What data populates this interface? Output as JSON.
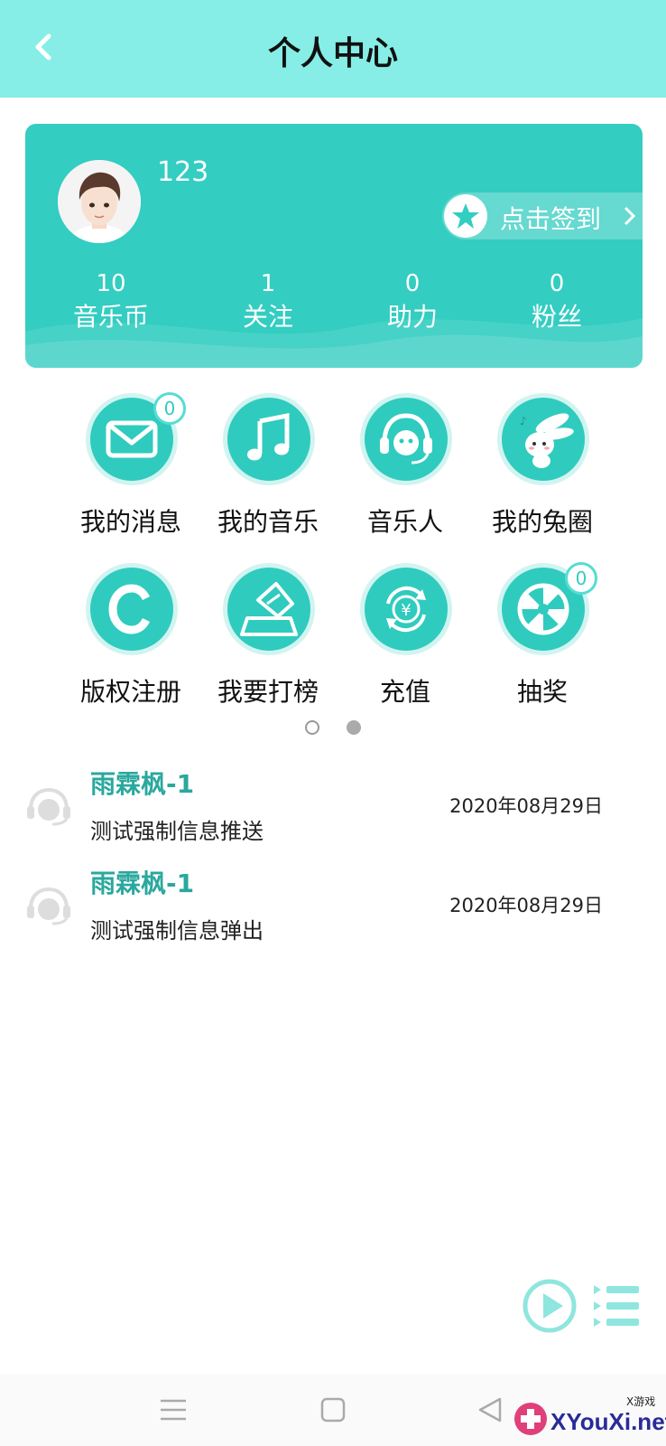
{
  "header": {
    "title": "个人中心"
  },
  "profile": {
    "username": "123",
    "checkin_label": "点击签到",
    "stats": [
      {
        "value": "10",
        "label": "音乐币"
      },
      {
        "value": "1",
        "label": "关注"
      },
      {
        "value": "0",
        "label": "助力"
      },
      {
        "value": "0",
        "label": "粉丝"
      }
    ]
  },
  "menu": {
    "items": [
      {
        "label": "我的消息",
        "icon": "mail-icon",
        "badge": "0"
      },
      {
        "label": "我的音乐",
        "icon": "music-note-icon"
      },
      {
        "label": "音乐人",
        "icon": "headset-icon"
      },
      {
        "label": "我的兔圈",
        "icon": "rabbit-icon"
      },
      {
        "label": "版权注册",
        "icon": "copyright-icon"
      },
      {
        "label": "我要打榜",
        "icon": "ticket-icon"
      },
      {
        "label": "充值",
        "icon": "yuan-coin-icon"
      },
      {
        "label": "抽奖",
        "icon": "lottery-wheel-icon",
        "badge": "0"
      }
    ],
    "page_indicator": {
      "pages": 2,
      "current": 2
    }
  },
  "messages": [
    {
      "sender": "雨霖枫-1",
      "text": "测试强制信息推送",
      "date": "2020年08月29日"
    },
    {
      "sender": "雨霖枫-1",
      "text": "测试强制信息弹出",
      "date": "2020年08月29日"
    }
  ],
  "watermark": {
    "text": "XYouXi.net",
    "small": "X游戏"
  },
  "colors": {
    "header": "#86EEE6",
    "accent": "#33CDC1",
    "sender": "#2AA89E"
  }
}
